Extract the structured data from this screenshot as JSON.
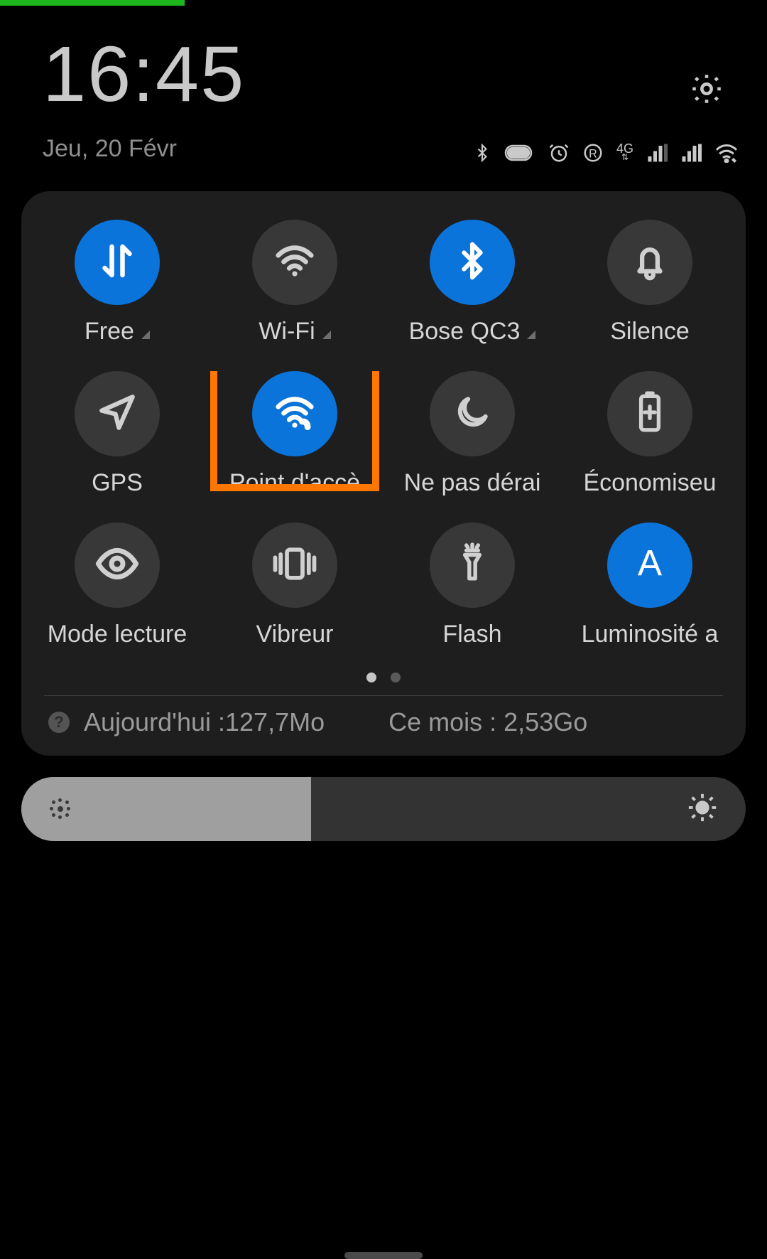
{
  "header": {
    "time": "16:45",
    "date": "Jeu, 20 Févr"
  },
  "status": {
    "network_type": "4G"
  },
  "tiles": [
    {
      "id": "mobile-data",
      "label": "Free",
      "on": true,
      "chevron": true,
      "icon": "data-arrows"
    },
    {
      "id": "wifi",
      "label": "Wi-Fi",
      "on": false,
      "chevron": true,
      "icon": "wifi"
    },
    {
      "id": "bluetooth",
      "label": "Bose QC3",
      "on": true,
      "chevron": true,
      "icon": "bluetooth"
    },
    {
      "id": "silence",
      "label": "Silence",
      "on": false,
      "chevron": false,
      "icon": "bell"
    },
    {
      "id": "gps",
      "label": "GPS",
      "on": false,
      "chevron": false,
      "icon": "location"
    },
    {
      "id": "hotspot",
      "label": "Point d'accè",
      "on": true,
      "chevron": false,
      "icon": "hotspot",
      "highlighted": true
    },
    {
      "id": "dnd",
      "label": "Ne pas dérai",
      "on": false,
      "chevron": false,
      "icon": "moon"
    },
    {
      "id": "battery-saver",
      "label": "Économiseu",
      "on": false,
      "chevron": false,
      "icon": "battery-plus"
    },
    {
      "id": "read-mode",
      "label": "Mode lecture",
      "on": false,
      "chevron": false,
      "icon": "eye"
    },
    {
      "id": "vibrate",
      "label": "Vibreur",
      "on": false,
      "chevron": false,
      "icon": "vibrate"
    },
    {
      "id": "flash",
      "label": "Flash",
      "on": false,
      "chevron": false,
      "icon": "flashlight"
    },
    {
      "id": "auto-brightness",
      "label": "Luminosité a",
      "on": true,
      "chevron": false,
      "icon": "auto-a"
    }
  ],
  "pager": {
    "current": 0,
    "total": 2
  },
  "data_usage": {
    "today_label": "Aujourd'hui :127,7Mo",
    "month_label": "Ce mois : 2,53Go"
  },
  "brightness": {
    "value_percent": 40
  }
}
